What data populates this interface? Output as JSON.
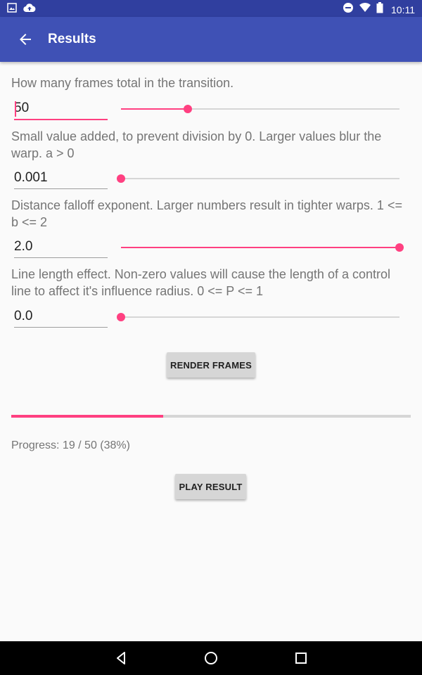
{
  "status_bar": {
    "time": "10:11",
    "left_icons": [
      "image-icon",
      "cloud-upload-icon"
    ],
    "right_icons": [
      "do-not-disturb-icon",
      "wifi-icon",
      "battery-icon"
    ]
  },
  "app_bar": {
    "title": "Results",
    "nav_icon": "back-arrow-icon"
  },
  "params": [
    {
      "label": "How many frames total in the transition.",
      "value": "50",
      "focused": true,
      "slider_fraction": 0.24
    },
    {
      "label": "Small value added, to prevent division by 0. Larger values blur the warp. a > 0",
      "value": "0.001",
      "focused": false,
      "slider_fraction": 0.0
    },
    {
      "label": "Distance falloff exponent. Larger numbers result in tighter warps. 1 <= b <= 2",
      "value": "2.0",
      "focused": false,
      "slider_fraction": 1.0
    },
    {
      "label": "Line length effect. Non-zero values will cause the length of a control line to affect it's influence radius. 0 <= P <= 1",
      "value": "0.0",
      "focused": false,
      "slider_fraction": 0.0
    }
  ],
  "render_button": {
    "label": "RENDER FRAMES"
  },
  "progress": {
    "fraction": 0.38,
    "text": "Progress: 19 / 50 (38%)"
  },
  "play_button": {
    "label": "PLAY RESULT"
  },
  "nav_bar": {
    "buttons": [
      "back-triangle-icon",
      "home-circle-icon",
      "recents-square-icon"
    ]
  },
  "colors": {
    "primary": "#3f51b5",
    "primary_dark": "#303f9f",
    "accent": "#ff4081",
    "background": "#fafafa"
  }
}
